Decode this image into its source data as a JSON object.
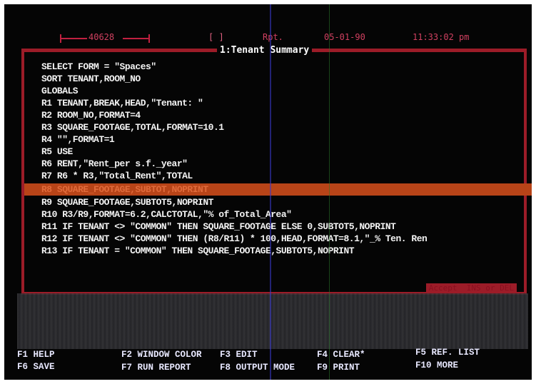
{
  "status_bar": {
    "memory": "40628",
    "bracket": "[ ]",
    "mode": "Rpt.",
    "date": "05-01-90",
    "time": "11:33:02 pm"
  },
  "window": {
    "title": "1:Tenant Summary",
    "lines": [
      "SELECT FORM = \"Spaces\"",
      "SORT TENANT,ROOM_NO",
      "GLOBALS",
      "R1 TENANT,BREAK,HEAD,\"Tenant: \"",
      "R2 ROOM_NO,FORMAT=4",
      "R3 SQUARE_FOOTAGE,TOTAL,FORMAT=10.1",
      "R4 \"\",FORMAT=1",
      "R5 USE",
      "R6 RENT,\"Rent_per s.f._year\"",
      "R7 R6 * R3,\"Total_Rent\",TOTAL",
      "R8 SQUARE_FOOTAGE,SUBTOT,NOPRINT",
      "R9 SQUARE_FOOTAGE,SUBTOT5,NOPRINT",
      "R10 R3/R9,FORMAT=6.2,CALCTOTAL,\"% of_Total_Area\"",
      "R11 IF TENANT <> \"COMMON\" THEN SQUARE_FOOTAGE ELSE 0,SUBTOT5,NOPRINT",
      "R12 IF TENANT <> \"COMMON\" THEN (R8/R11) * 100,HEAD,FORMAT=8.1,\"_% Ten. Ren",
      "R13 IF TENANT = \"COMMON\" THEN SQUARE_FOOTAGE,SUBTOT5,NOPRINT"
    ],
    "selected_line_index": 10,
    "bottom_prompt": "Accept  INS or DEL"
  },
  "function_keys": [
    {
      "key": "F1",
      "label": "HELP"
    },
    {
      "key": "F2",
      "label": "WINDOW COLOR"
    },
    {
      "key": "F3",
      "label": "EDIT"
    },
    {
      "key": "F4",
      "label": "CLEAR*"
    },
    {
      "key": "F5",
      "label": "REF. LIST"
    },
    {
      "key": "F6",
      "label": "SAVE"
    },
    {
      "key": "F7",
      "label": "RUN REPORT"
    },
    {
      "key": "F8",
      "label": "OUTPUT MODE"
    },
    {
      "key": "F9",
      "label": "PRINT"
    },
    {
      "key": "F10",
      "label": "MORE"
    }
  ],
  "colors": {
    "screen_bg": "#050505",
    "frame": "#9c1c28",
    "text": "#f4f4f4",
    "selection": "#b84418",
    "status_text": "#d04060"
  }
}
